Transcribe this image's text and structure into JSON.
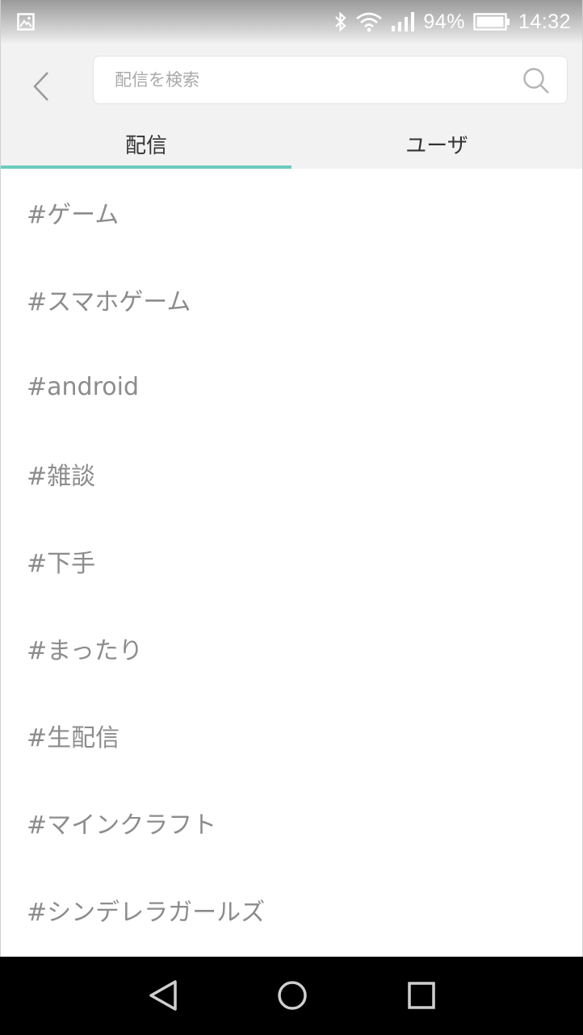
{
  "status_bar": {
    "battery_percent": "94%",
    "time": "14:32",
    "icons": [
      "gallery-icon",
      "bluetooth-icon",
      "wifi-icon",
      "signal-icon",
      "battery-icon"
    ]
  },
  "search": {
    "placeholder": "配信を検索",
    "value": ""
  },
  "tabs": [
    {
      "label": "配信",
      "active": true
    },
    {
      "label": "ユーザ",
      "active": false
    }
  ],
  "tags": [
    "#ゲーム",
    "#スマホゲーム",
    "#android",
    "#雑談",
    "#下手",
    "#まったり",
    "#生配信",
    "#マインクラフト",
    "#シンデレラガールズ"
  ],
  "colors": {
    "accent": "#6ccbbd",
    "tag_text": "#8c8c8c",
    "header_bg": "#f2f2f2"
  }
}
